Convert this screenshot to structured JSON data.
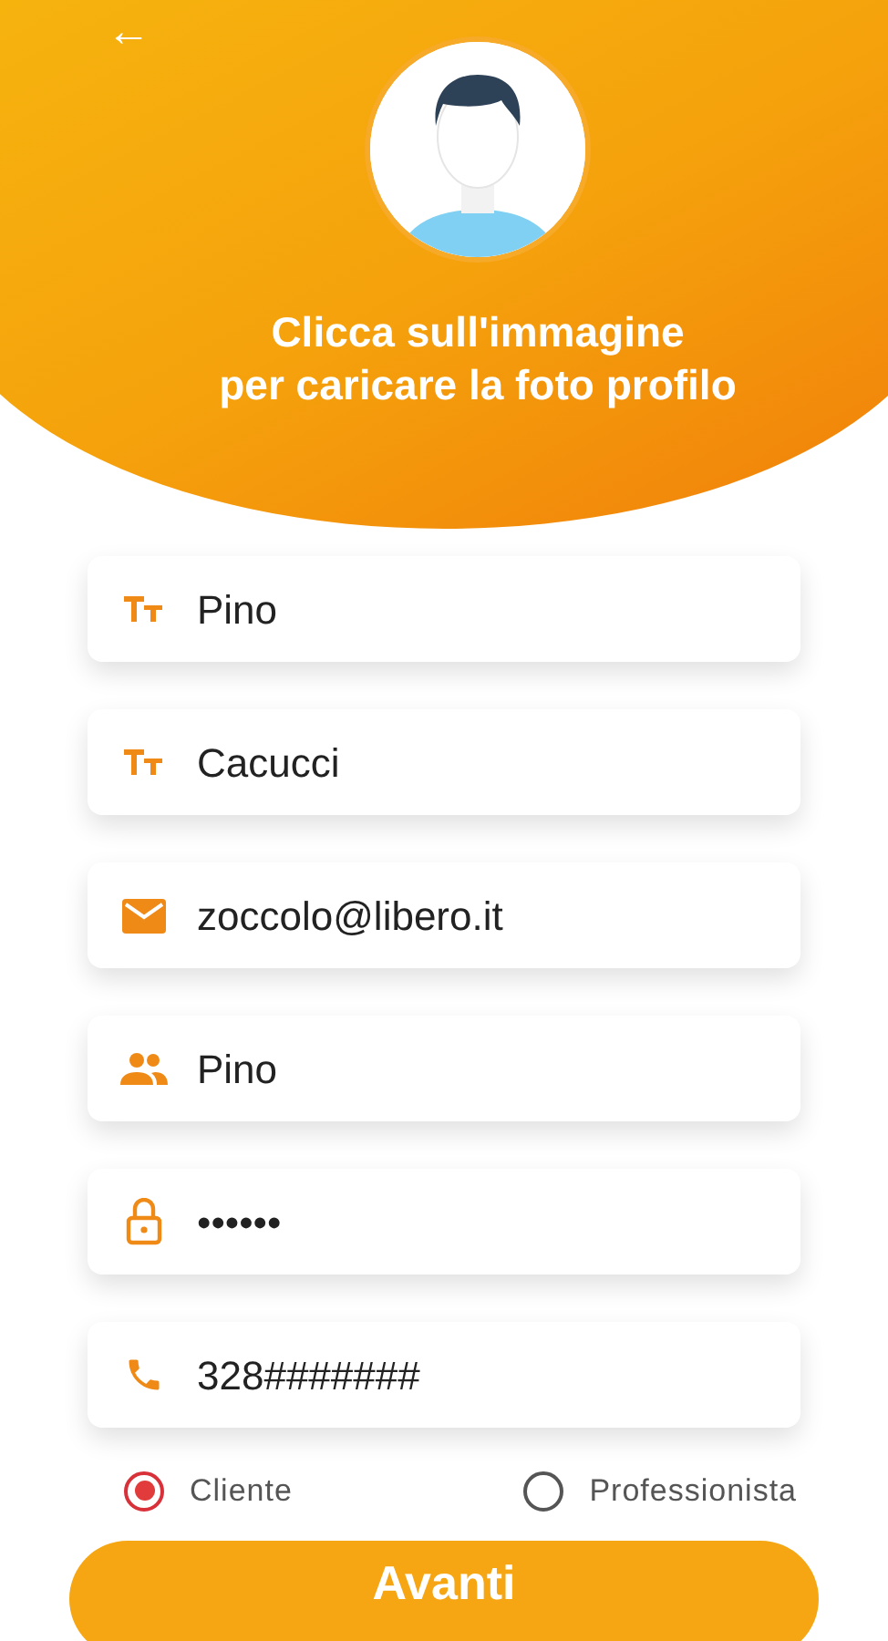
{
  "header": {
    "back": "←",
    "prompt": "Clicca sull'immagine\nper caricare la foto profilo"
  },
  "fields": [
    {
      "kind": "text",
      "value": "Pino"
    },
    {
      "kind": "text",
      "value": "Cacucci"
    },
    {
      "kind": "email",
      "value": "zoccolo@libero.it"
    },
    {
      "kind": "people",
      "value": "Pino"
    },
    {
      "kind": "lock",
      "value": "••••••"
    },
    {
      "kind": "phone",
      "value": "328#######"
    }
  ],
  "roles": [
    {
      "label": "Cliente",
      "selected": true
    },
    {
      "label": "Professionista",
      "selected": false
    }
  ],
  "submit": "Avanti"
}
